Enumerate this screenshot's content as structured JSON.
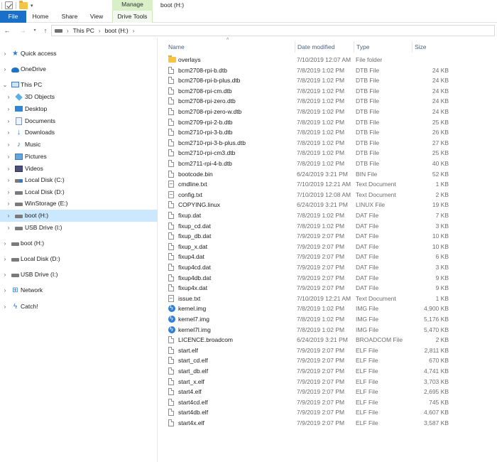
{
  "window": {
    "title": "boot (H:)",
    "context_tab_group": "Manage"
  },
  "ribbon": {
    "tabs": [
      {
        "label": "File"
      },
      {
        "label": "Home"
      },
      {
        "label": "Share"
      },
      {
        "label": "View"
      },
      {
        "label": "Drive Tools"
      }
    ]
  },
  "address": {
    "crumbs": [
      "This PC",
      "boot (H:)"
    ]
  },
  "nav_pane": {
    "items": [
      {
        "label": "Quick access",
        "icon": "quick-access-icon"
      },
      {
        "label": "OneDrive",
        "icon": "onedrive-icon"
      },
      {
        "label": "This PC",
        "icon": "this-pc-icon"
      },
      {
        "label": "3D Objects",
        "icon": "3d-objects-icon"
      },
      {
        "label": "Desktop",
        "icon": "desktop-icon"
      },
      {
        "label": "Documents",
        "icon": "documents-icon"
      },
      {
        "label": "Downloads",
        "icon": "downloads-icon"
      },
      {
        "label": "Music",
        "icon": "music-icon"
      },
      {
        "label": "Pictures",
        "icon": "pictures-icon"
      },
      {
        "label": "Videos",
        "icon": "videos-icon"
      },
      {
        "label": "Local Disk (C:)",
        "icon": "windows-disk-icon"
      },
      {
        "label": "Local Disk (D:)",
        "icon": "disk-icon"
      },
      {
        "label": "WinStorage (E:)",
        "icon": "disk-icon"
      },
      {
        "label": "boot (H:)",
        "icon": "disk-icon",
        "selected": true
      },
      {
        "label": "USB Drive (I:)",
        "icon": "usb-drive-icon"
      },
      {
        "label": "boot (H:)",
        "icon": "disk-icon"
      },
      {
        "label": "Local Disk (D:)",
        "icon": "disk-icon"
      },
      {
        "label": "USB Drive (I:)",
        "icon": "usb-drive-icon"
      },
      {
        "label": "Network",
        "icon": "network-icon"
      },
      {
        "label": "Catch!",
        "icon": "catch-icon"
      }
    ]
  },
  "file_list": {
    "columns": {
      "name": "Name",
      "date": "Date modified",
      "type": "Type",
      "size": "Size"
    },
    "rows": [
      {
        "name": "overlays",
        "date": "7/10/2019 12:07 AM",
        "type": "File folder",
        "size": "",
        "icon": "folder"
      },
      {
        "name": "bcm2708-rpi-b.dtb",
        "date": "7/8/2019 1:02 PM",
        "type": "DTB File",
        "size": "24 KB",
        "icon": "doc"
      },
      {
        "name": "bcm2708-rpi-b-plus.dtb",
        "date": "7/8/2019 1:02 PM",
        "type": "DTB File",
        "size": "24 KB",
        "icon": "doc"
      },
      {
        "name": "bcm2708-rpi-cm.dtb",
        "date": "7/8/2019 1:02 PM",
        "type": "DTB File",
        "size": "24 KB",
        "icon": "doc"
      },
      {
        "name": "bcm2708-rpi-zero.dtb",
        "date": "7/8/2019 1:02 PM",
        "type": "DTB File",
        "size": "24 KB",
        "icon": "doc"
      },
      {
        "name": "bcm2708-rpi-zero-w.dtb",
        "date": "7/8/2019 1:02 PM",
        "type": "DTB File",
        "size": "24 KB",
        "icon": "doc"
      },
      {
        "name": "bcm2709-rpi-2-b.dtb",
        "date": "7/8/2019 1:02 PM",
        "type": "DTB File",
        "size": "25 KB",
        "icon": "doc"
      },
      {
        "name": "bcm2710-rpi-3-b.dtb",
        "date": "7/8/2019 1:02 PM",
        "type": "DTB File",
        "size": "26 KB",
        "icon": "doc"
      },
      {
        "name": "bcm2710-rpi-3-b-plus.dtb",
        "date": "7/8/2019 1:02 PM",
        "type": "DTB File",
        "size": "27 KB",
        "icon": "doc"
      },
      {
        "name": "bcm2710-rpi-cm3.dtb",
        "date": "7/8/2019 1:02 PM",
        "type": "DTB File",
        "size": "25 KB",
        "icon": "doc"
      },
      {
        "name": "bcm2711-rpi-4-b.dtb",
        "date": "7/8/2019 1:02 PM",
        "type": "DTB File",
        "size": "40 KB",
        "icon": "doc"
      },
      {
        "name": "bootcode.bin",
        "date": "6/24/2019 3:21 PM",
        "type": "BIN File",
        "size": "52 KB",
        "icon": "doc"
      },
      {
        "name": "cmdline.txt",
        "date": "7/10/2019 12:21 AM",
        "type": "Text Document",
        "size": "1 KB",
        "icon": "txt"
      },
      {
        "name": "config.txt",
        "date": "7/10/2019 12:08 AM",
        "type": "Text Document",
        "size": "2 KB",
        "icon": "txt"
      },
      {
        "name": "COPYING.linux",
        "date": "6/24/2019 3:21 PM",
        "type": "LINUX File",
        "size": "19 KB",
        "icon": "doc"
      },
      {
        "name": "fixup.dat",
        "date": "7/8/2019 1:02 PM",
        "type": "DAT File",
        "size": "7 KB",
        "icon": "doc"
      },
      {
        "name": "fixup_cd.dat",
        "date": "7/8/2019 1:02 PM",
        "type": "DAT File",
        "size": "3 KB",
        "icon": "doc"
      },
      {
        "name": "fixup_db.dat",
        "date": "7/9/2019 2:07 PM",
        "type": "DAT File",
        "size": "10 KB",
        "icon": "doc"
      },
      {
        "name": "fixup_x.dat",
        "date": "7/9/2019 2:07 PM",
        "type": "DAT File",
        "size": "10 KB",
        "icon": "doc"
      },
      {
        "name": "fixup4.dat",
        "date": "7/9/2019 2:07 PM",
        "type": "DAT File",
        "size": "6 KB",
        "icon": "doc"
      },
      {
        "name": "fixup4cd.dat",
        "date": "7/9/2019 2:07 PM",
        "type": "DAT File",
        "size": "3 KB",
        "icon": "doc"
      },
      {
        "name": "fixup4db.dat",
        "date": "7/9/2019 2:07 PM",
        "type": "DAT File",
        "size": "9 KB",
        "icon": "doc"
      },
      {
        "name": "fixup4x.dat",
        "date": "7/9/2019 2:07 PM",
        "type": "DAT File",
        "size": "9 KB",
        "icon": "doc"
      },
      {
        "name": "issue.txt",
        "date": "7/10/2019 12:21 AM",
        "type": "Text Document",
        "size": "1 KB",
        "icon": "txt"
      },
      {
        "name": "kernel.img",
        "date": "7/8/2019 1:02 PM",
        "type": "IMG File",
        "size": "4,900 KB",
        "icon": "img"
      },
      {
        "name": "kernel7.img",
        "date": "7/8/2019 1:02 PM",
        "type": "IMG File",
        "size": "5,176 KB",
        "icon": "img"
      },
      {
        "name": "kernel7l.img",
        "date": "7/8/2019 1:02 PM",
        "type": "IMG File",
        "size": "5,470 KB",
        "icon": "img"
      },
      {
        "name": "LICENCE.broadcom",
        "date": "6/24/2019 3:21 PM",
        "type": "BROADCOM File",
        "size": "2 KB",
        "icon": "doc"
      },
      {
        "name": "start.elf",
        "date": "7/9/2019 2:07 PM",
        "type": "ELF File",
        "size": "2,811 KB",
        "icon": "doc"
      },
      {
        "name": "start_cd.elf",
        "date": "7/9/2019 2:07 PM",
        "type": "ELF File",
        "size": "670 KB",
        "icon": "doc"
      },
      {
        "name": "start_db.elf",
        "date": "7/9/2019 2:07 PM",
        "type": "ELF File",
        "size": "4,741 KB",
        "icon": "doc"
      },
      {
        "name": "start_x.elf",
        "date": "7/9/2019 2:07 PM",
        "type": "ELF File",
        "size": "3,703 KB",
        "icon": "doc"
      },
      {
        "name": "start4.elf",
        "date": "7/9/2019 2:07 PM",
        "type": "ELF File",
        "size": "2,695 KB",
        "icon": "doc"
      },
      {
        "name": "start4cd.elf",
        "date": "7/9/2019 2:07 PM",
        "type": "ELF File",
        "size": "745 KB",
        "icon": "doc"
      },
      {
        "name": "start4db.elf",
        "date": "7/9/2019 2:07 PM",
        "type": "ELF File",
        "size": "4,607 KB",
        "icon": "doc"
      },
      {
        "name": "start4x.elf",
        "date": "7/9/2019 2:07 PM",
        "type": "ELF File",
        "size": "3,587 KB",
        "icon": "doc"
      }
    ]
  },
  "colors": {
    "file_tab": "#1a6fc9",
    "manage_tab": "#d9efc7",
    "selection": "#cce8ff",
    "folder": "#f6c443"
  }
}
